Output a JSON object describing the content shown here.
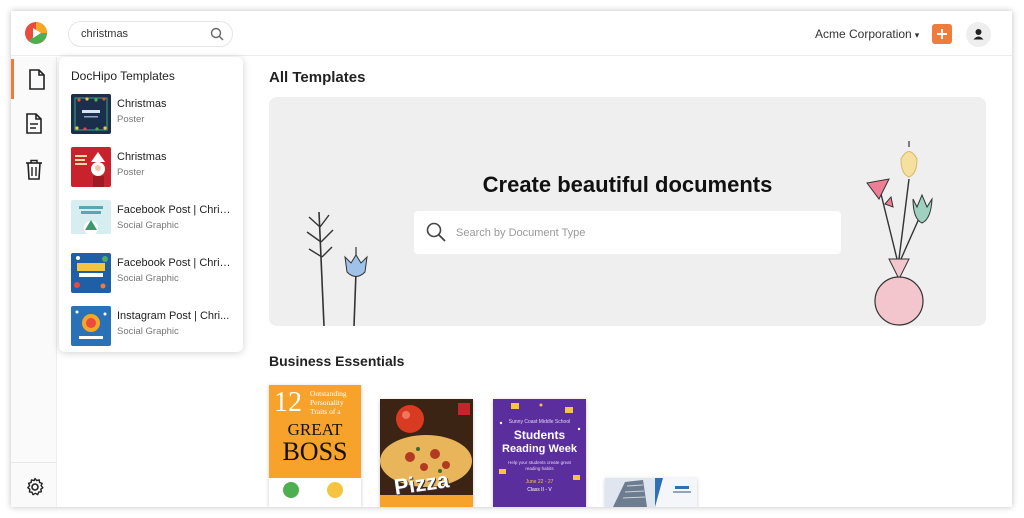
{
  "search": {
    "value": "christmas",
    "placeholder": "Search"
  },
  "header": {
    "org_name": "Acme Corporation",
    "org_chevron": "▾",
    "add_label": "+"
  },
  "dropdown": {
    "title": "DocHipo Templates",
    "items": [
      {
        "name": "Christmas",
        "type": "Poster"
      },
      {
        "name": "Christmas",
        "type": "Poster"
      },
      {
        "name": "Facebook Post | Chris...",
        "type": "Social Graphic"
      },
      {
        "name": "Facebook Post | Chris...",
        "type": "Social Graphic"
      },
      {
        "name": "Instagram Post | Chri...",
        "type": "Social Graphic"
      }
    ]
  },
  "main": {
    "title": "All Templates",
    "hero_title": "Create beautiful documents",
    "hero_search_placeholder": "Search by Document Type",
    "section_title": "Business Essentials"
  },
  "cards": {
    "boss": {
      "number": "12",
      "line1": "Outstanding",
      "line2": "Personality",
      "line3": "Traits of a",
      "big1": "GREAT",
      "big2": "BOSS"
    },
    "pizza": {
      "word": "Pizza"
    },
    "reading": {
      "school": "Sunny Coast Middle School",
      "line1": "Students",
      "line2": "Reading Week",
      "sub": "Help your students create great reading habits",
      "dates": "June 22 - 27",
      "class": "Class II - V"
    }
  },
  "colors": {
    "accent": "#f07c3b",
    "hero_bg": "#efefef"
  }
}
